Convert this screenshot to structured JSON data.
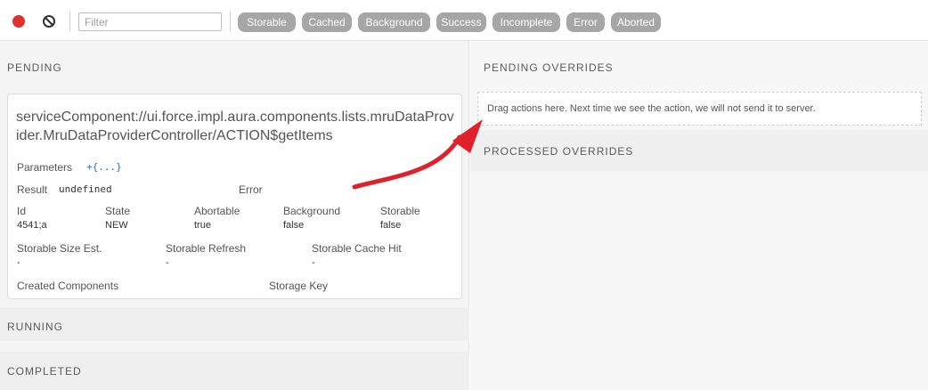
{
  "toolbar": {
    "filter_placeholder": "Filter",
    "filters": [
      "Storable",
      "Cached",
      "Background",
      "Success",
      "Incomplete",
      "Error",
      "Aborted"
    ]
  },
  "left": {
    "pending_title": "PENDING",
    "running_title": "RUNNING",
    "completed_title": "COMPLETED",
    "action": {
      "name": "serviceComponent://ui.force.impl.aura.components.lists.mruDataProvider.MruDataProviderController/ACTION$getItems",
      "parameters_label": "Parameters",
      "parameters_value": "+{...}",
      "result_label": "Result",
      "result_value": "undefined",
      "error_label": "Error",
      "id_label": "Id",
      "id_value": "4541;a",
      "state_label": "State",
      "state_value": "NEW",
      "abortable_label": "Abortable",
      "abortable_value": "true",
      "background_label": "Background",
      "background_value": "false",
      "storable_label": "Storable",
      "storable_value": "false",
      "storable_size_label": "Storable Size Est.",
      "storable_size_value": "-",
      "storable_refresh_label": "Storable Refresh",
      "storable_refresh_value": "-",
      "storable_cache_hit_label": "Storable Cache Hit",
      "storable_cache_hit_value": "-",
      "created_components_label": "Created Components",
      "storage_key_label": "Storage Key"
    }
  },
  "right": {
    "pending_overrides_title": "PENDING OVERRIDES",
    "dropzone_text": "Drag actions here. Next time we see the action, we will not send it to server.",
    "processed_overrides_title": "PROCESSED OVERRIDES"
  },
  "colors": {
    "record": "#e03131",
    "filter_tag": "#a6a6a6",
    "arrow": "#e0202a",
    "link": "#1a73e8"
  }
}
